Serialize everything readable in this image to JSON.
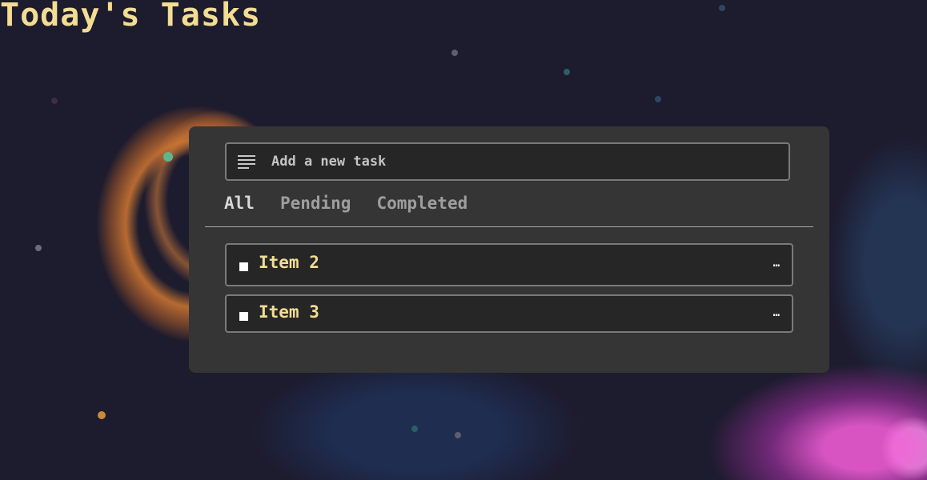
{
  "header": {
    "title": "Today's Tasks"
  },
  "input": {
    "placeholder": "Add a new task",
    "icon": "notes-icon"
  },
  "tabs": [
    {
      "label": "All",
      "active": true
    },
    {
      "label": "Pending",
      "active": false
    },
    {
      "label": "Completed",
      "active": false
    }
  ],
  "tasks": [
    {
      "label": "Item 2",
      "checked": false,
      "menu_icon": "more-icon",
      "menu_glyph": "…"
    },
    {
      "label": "Item 3",
      "checked": false,
      "menu_icon": "more-icon",
      "menu_glyph": "…"
    }
  ],
  "colors": {
    "title": "#f2dd93",
    "task_text": "#f2dd93",
    "panel_bg": "#353535",
    "field_bg": "#262626",
    "border": "#7a7a7a",
    "page_bg": "#1d1b2e"
  }
}
